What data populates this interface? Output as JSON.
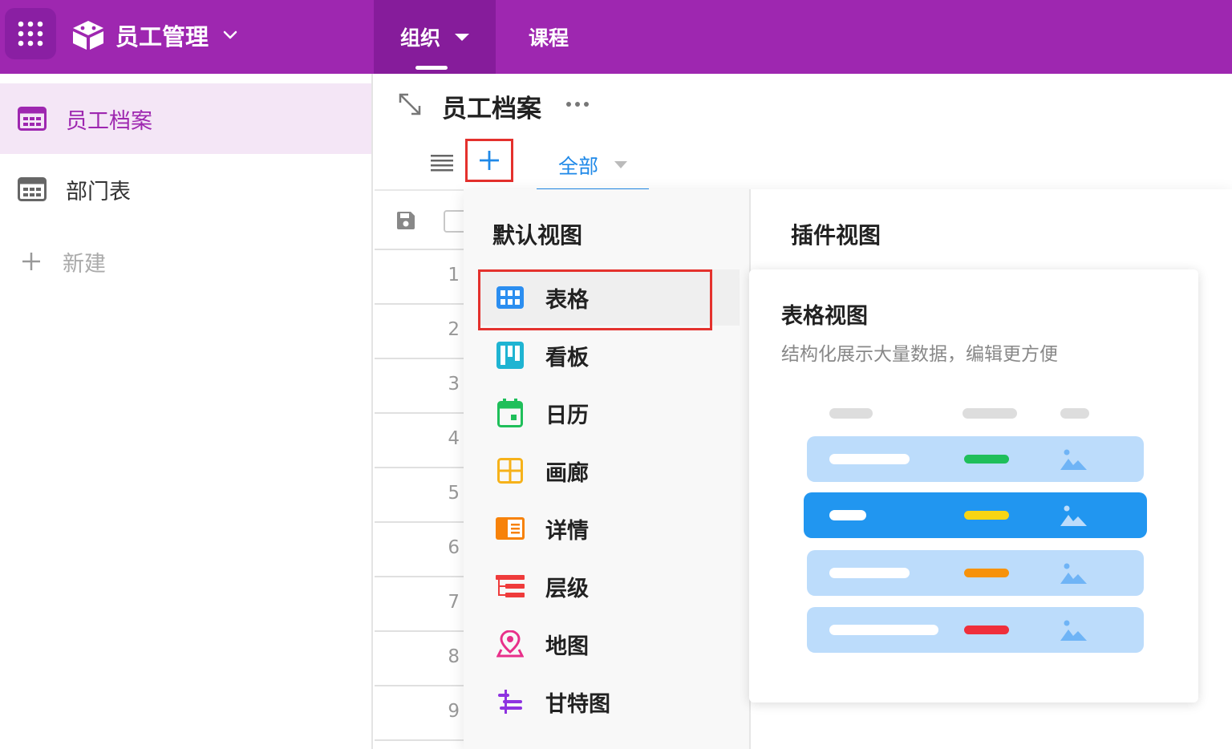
{
  "topbar": {
    "app_title": "员工管理",
    "tabs": [
      {
        "label": "组织",
        "active": true
      },
      {
        "label": "课程",
        "active": false
      }
    ]
  },
  "sidebar": {
    "items": [
      {
        "label": "员工档案",
        "active": true
      },
      {
        "label": "部门表",
        "active": false
      }
    ],
    "new_label": "新建"
  },
  "main": {
    "title": "员工档案",
    "view_tab_label": "全部",
    "row_numbers": [
      "1",
      "2",
      "3",
      "4",
      "5",
      "6",
      "7",
      "8",
      "9"
    ]
  },
  "dropdown": {
    "default_heading": "默认视图",
    "plugin_heading": "插件视图",
    "items": [
      {
        "label": "表格",
        "icon": "grid-icon",
        "color": "#2b8ef0"
      },
      {
        "label": "看板",
        "icon": "kanban-icon",
        "color": "#1fb4d2"
      },
      {
        "label": "日历",
        "icon": "calendar-icon",
        "color": "#1fbf5a"
      },
      {
        "label": "画廊",
        "icon": "gallery-icon",
        "color": "#f6b21a"
      },
      {
        "label": "详情",
        "icon": "detail-icon",
        "color": "#f7820a"
      },
      {
        "label": "层级",
        "icon": "hierarchy-icon",
        "color": "#ef3b3b"
      },
      {
        "label": "地图",
        "icon": "map-pin-icon",
        "color": "#e8308a"
      },
      {
        "label": "甘特图",
        "icon": "gantt-icon",
        "color": "#8e33e0"
      }
    ],
    "preview": {
      "title": "表格视图",
      "description": "结构化展示大量数据，编辑更方便"
    }
  },
  "colors": {
    "brand": "#9e27b0",
    "accent": "#1f89e8",
    "highlight": "#e4312d"
  }
}
